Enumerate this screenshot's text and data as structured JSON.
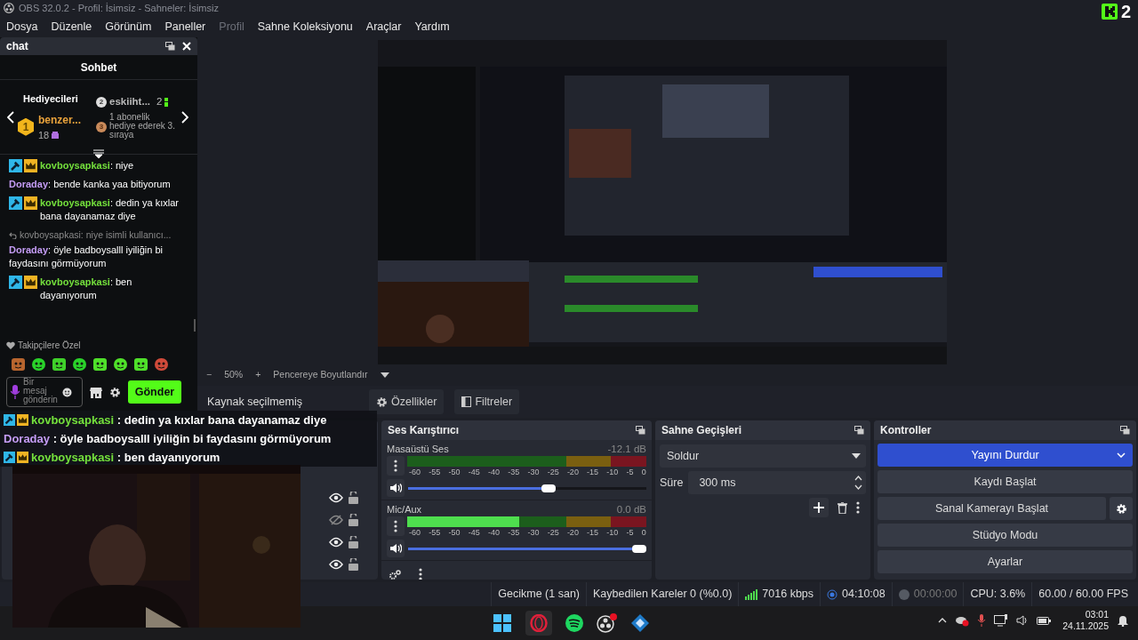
{
  "window": {
    "title": "OBS 32.0.2 - Profil: İsimsiz - Sahneler: İsimsiz"
  },
  "corner_logo": {
    "text": "2"
  },
  "menu": [
    {
      "label": "Dosya",
      "disabled": false
    },
    {
      "label": "Düzenle",
      "disabled": false
    },
    {
      "label": "Görünüm",
      "disabled": false
    },
    {
      "label": "Paneller",
      "disabled": false
    },
    {
      "label": "Profil",
      "disabled": true
    },
    {
      "label": "Sahne Koleksiyonu",
      "disabled": false
    },
    {
      "label": "Araçlar",
      "disabled": false
    },
    {
      "label": "Yardım",
      "disabled": false
    }
  ],
  "chat_dock": {
    "title": "chat",
    "header": "Sohbet",
    "gifters": {
      "title": "Hediyecileri",
      "first": {
        "rank": "1",
        "name": "benzer...",
        "count": "18"
      },
      "second": {
        "rank": "2",
        "name": "eskiiht...",
        "count": "2"
      },
      "third": {
        "rank": "3",
        "text": "1 abonelik hediye ederek 3. sıraya"
      }
    },
    "messages": [
      {
        "kind": "message",
        "user": "kovboysapkasi",
        "color": "#74e03c",
        "badges": true,
        "text": ": niye"
      },
      {
        "kind": "message",
        "user": "Doraday",
        "color": "#c49cf5",
        "badges": false,
        "text": ": bende kanka yaa bitiyorum"
      },
      {
        "kind": "message",
        "user": "kovboysapkasi",
        "color": "#74e03c",
        "badges": true,
        "text": ": dedin ya kıxlar bana dayanamaz diye"
      },
      {
        "kind": "reply",
        "text": "kovboysapkasi: niye isimli kullanıcı..."
      },
      {
        "kind": "message",
        "user": "Doraday",
        "color": "#c49cf5",
        "badges": false,
        "text": ": öyle badboysalll iyiliğin bi faydasını görmüyorum"
      },
      {
        "kind": "message",
        "user": "kovboysapkasi",
        "color": "#74e03c",
        "badges": true,
        "text": ": ben dayanıyorum"
      }
    ],
    "emote_section": "Takipçilere Özel",
    "input": {
      "placeholder": "Bir mesaj gönderin"
    },
    "send_button": "Gönder"
  },
  "zoom_bar": {
    "minus": "−",
    "zoom": "50%",
    "plus": "+",
    "fit": "Pencereye Boyutlandır"
  },
  "source_bar": {
    "status": "Kaynak seçilmemiş",
    "properties": "Özellikler",
    "filters": "Filtreler"
  },
  "sources": {
    "items": [
      {
        "visible": true,
        "locked": false
      },
      {
        "visible": false,
        "locked": false
      },
      {
        "visible": true,
        "locked": false
      },
      {
        "visible": true,
        "locked": false
      }
    ]
  },
  "mixer": {
    "title": "Ses Karıştırıcı",
    "channels": [
      {
        "name": "Masaüstü Ses",
        "reading": "-12.1 dB",
        "volume": {
          "level": 0.62
        },
        "ticks": [
          "-60",
          "-55",
          "-50",
          "-45",
          "-40",
          "-35",
          "-30",
          "-25",
          "-20",
          "-15",
          "-10",
          "-5",
          "0"
        ]
      },
      {
        "name": "Mic/Aux",
        "reading": "0.0 dB",
        "meter": {
          "level": 0.47
        },
        "volume": {
          "level": 1
        },
        "ticks": [
          "-60",
          "-55",
          "-50",
          "-45",
          "-40",
          "-35",
          "-30",
          "-25",
          "-20",
          "-15",
          "-10",
          "-5",
          "0"
        ]
      }
    ]
  },
  "transitions": {
    "title": "Sahne Geçişleri",
    "transition": "Soldur",
    "duration_label": "Süre",
    "duration": "300 ms"
  },
  "controls": {
    "title": "Kontroller",
    "buttons": [
      {
        "label": "Yayını Durdur",
        "active": true,
        "kind": "dropdown"
      },
      {
        "label": "Kaydı Başlat",
        "active": false,
        "kind": "plain"
      },
      {
        "label": "Sanal Kamerayı Başlat",
        "active": false,
        "kind": "gear"
      },
      {
        "label": "Stüdyo Modu",
        "active": false,
        "kind": "plain"
      },
      {
        "label": "Ayarlar",
        "active": false,
        "kind": "plain"
      }
    ]
  },
  "status_bar": {
    "delay": "Gecikme (1 san)",
    "dropped": "Kaybedilen Kareler 0 (%0.0)",
    "bitrate": "7016 kbps",
    "stream_time": "04:10:08",
    "record_time": "00:00:00",
    "cpu": "CPU: 3.6%",
    "fps": "60.00 / 60.00 FPS"
  },
  "overlay_chat": [
    {
      "user": "kovboysapkasi",
      "color": "#74e03c",
      "badges": true,
      "text": " : dedin ya kıxlar bana dayanamaz diye"
    },
    {
      "user": "Doraday",
      "color": "#c49cf5",
      "badges": false,
      "text": " : öyle badboysalll iyiliğin bi faydasını görmüyorum"
    },
    {
      "user": "kovboysapkasi",
      "color": "#74e03c",
      "badges": true,
      "text": " : ben dayanıyorum"
    }
  ],
  "taskbar": {
    "time": "03:01",
    "date": "24.11.2025"
  }
}
